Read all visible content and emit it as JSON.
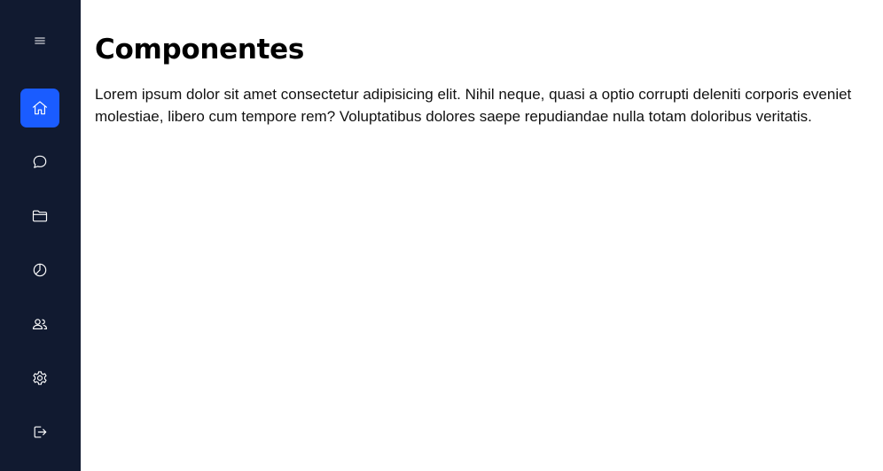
{
  "sidebar": {
    "background": "#111a30",
    "accent": "#1a5cff",
    "items": [
      {
        "name": "menu",
        "icon": "menu-icon",
        "active": false
      },
      {
        "name": "home",
        "icon": "home-icon",
        "active": true
      },
      {
        "name": "messages",
        "icon": "chat-icon",
        "active": false
      },
      {
        "name": "folder",
        "icon": "folder-icon",
        "active": false
      },
      {
        "name": "reports",
        "icon": "pie-chart-icon",
        "active": false
      },
      {
        "name": "users",
        "icon": "users-icon",
        "active": false
      },
      {
        "name": "settings",
        "icon": "gear-icon",
        "active": false
      },
      {
        "name": "logout",
        "icon": "logout-icon",
        "active": false
      }
    ]
  },
  "main": {
    "title": "Componentes",
    "body": "Lorem ipsum dolor sit amet consectetur adipisicing elit. Nihil neque, quasi a optio corrupti deleniti corporis eveniet molestiae, libero cum tempore rem? Voluptatibus dolores saepe repudiandae nulla totam doloribus veritatis."
  }
}
